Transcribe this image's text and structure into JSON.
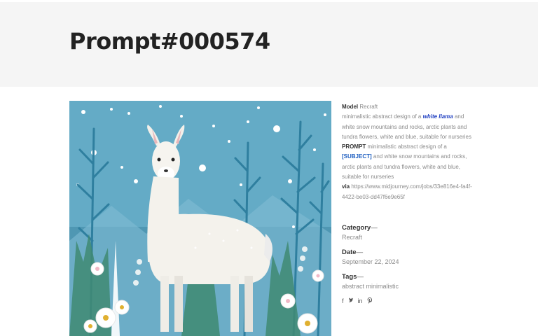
{
  "page": {
    "title": "Prompt#000574"
  },
  "details": {
    "model_label": "Model",
    "model_value": "Recraft",
    "description_before": "minimalistic abstract design of a ",
    "description_keyword": "white llama",
    "description_after": " and white snow mountains and rocks, arctic plants and tundra flowers, white and blue, suitable for nurseries",
    "prompt_label": "PROMPT",
    "prompt_before": " minimalistic abstract design of a ",
    "prompt_keyword": "[SUBJECT]",
    "prompt_after": " and white snow mountains and rocks, arctic plants and tundra flowers, white and blue, suitable for nurseries",
    "via_label": "via",
    "via_url": "https://www.midjourney.com/jobs/33e816e4-fa4f-4422-be03-dd47f6e9e65f"
  },
  "category": {
    "label": "Category",
    "dash": "—",
    "value": "Recraft"
  },
  "date": {
    "label": "Date",
    "dash": "—",
    "value": "September 22, 2024"
  },
  "tags": {
    "label": "Tags",
    "dash": "—",
    "value": "abstract minimalistic"
  },
  "share": {
    "facebook": "f",
    "twitter": "t",
    "linkedin": "in",
    "pinterest": "p"
  },
  "colors": {
    "header_bg": "#f5f5f5",
    "art_bg": "#5fa8c4",
    "link": "#1f3fc1"
  }
}
